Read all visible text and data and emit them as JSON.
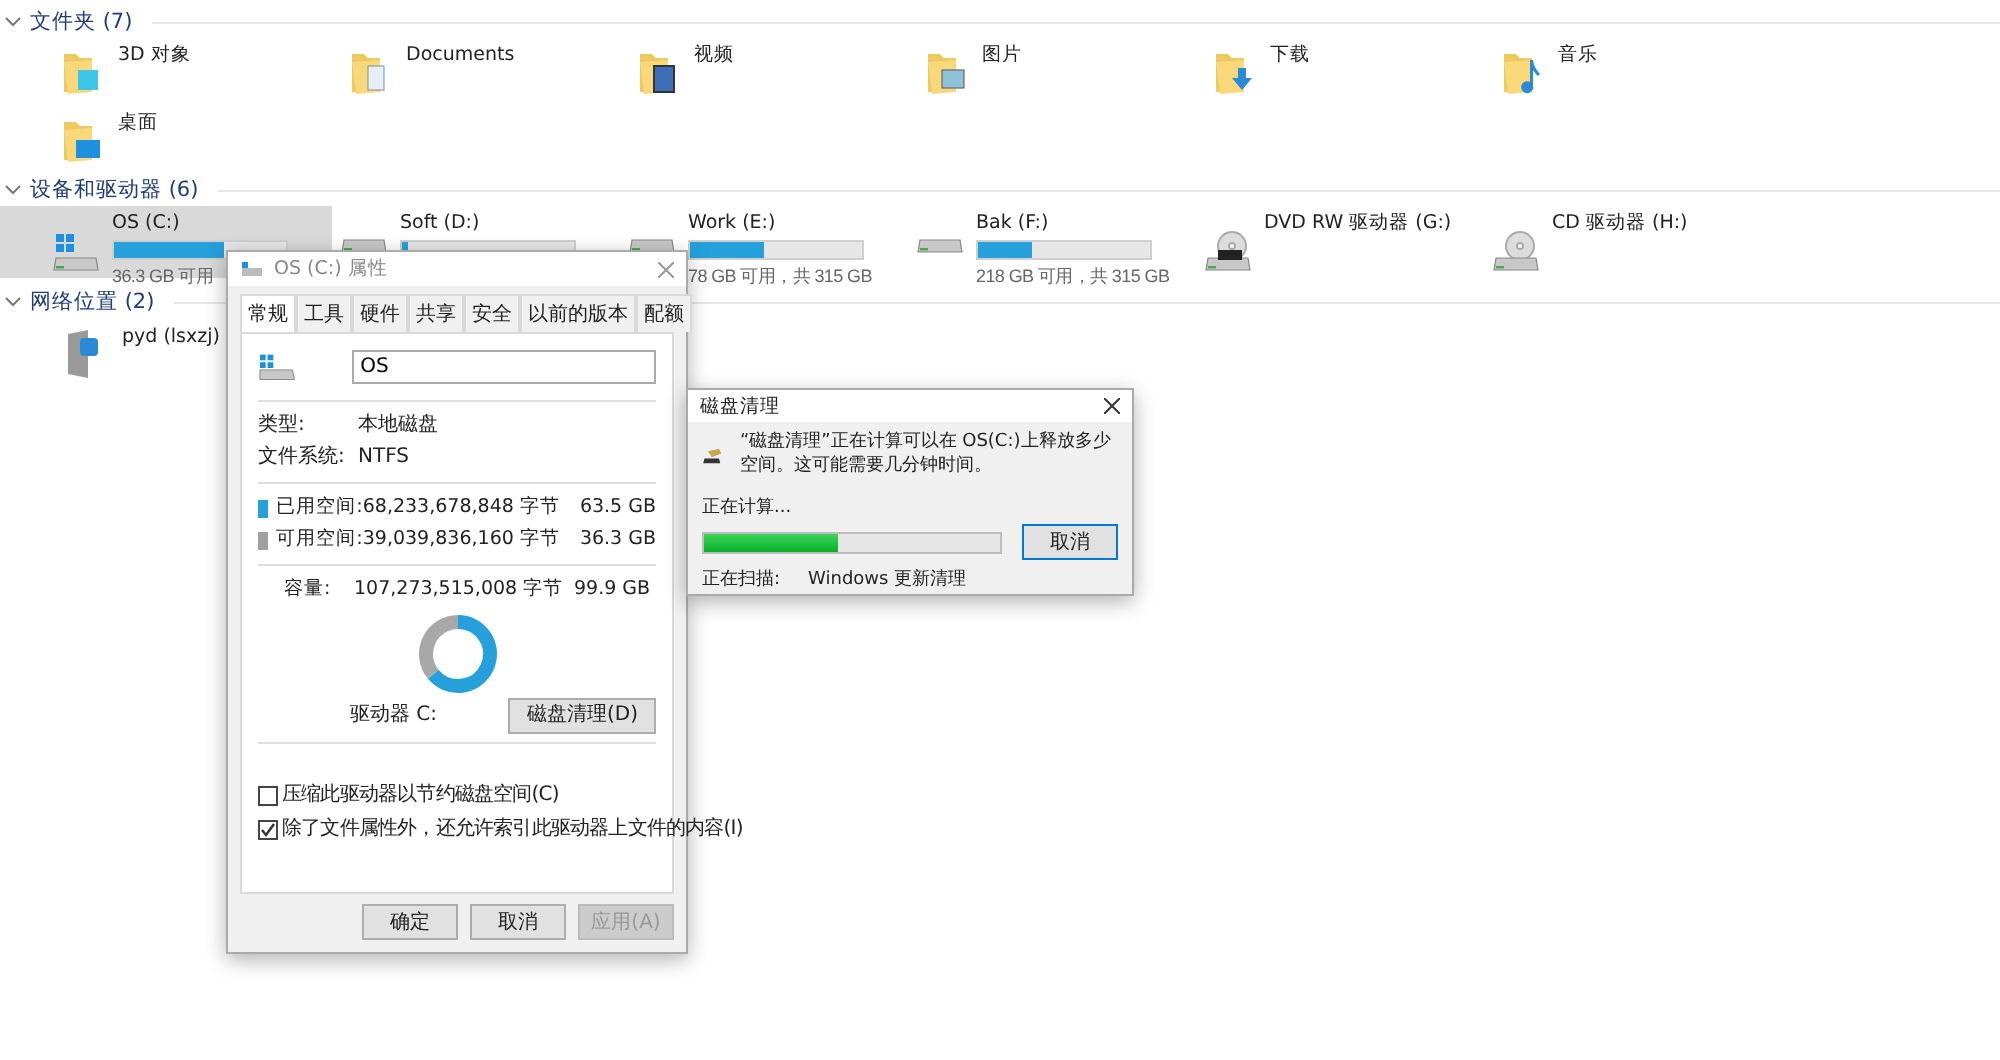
{
  "groups": [
    {
      "title": "文件夹 (7)",
      "kind": "folders",
      "items": [
        {
          "name": "3D 对象",
          "kind": "objects"
        },
        {
          "name": "Documents",
          "kind": "documents"
        },
        {
          "name": "视频",
          "kind": "videos"
        },
        {
          "name": "图片",
          "kind": "pictures"
        },
        {
          "name": "下载",
          "kind": "downloads"
        },
        {
          "name": "音乐",
          "kind": "music"
        },
        {
          "name": "桌面",
          "kind": "desktop"
        }
      ]
    },
    {
      "title": "设备和驱动器 (6)",
      "kind": "drives",
      "items": [
        {
          "name": "OS (C:)",
          "kind": "system",
          "selected": true,
          "level": 0.64,
          "subtitle": "36.3 GB 可用"
        },
        {
          "name": "Soft (D:)",
          "kind": "hdd",
          "selected": false,
          "level": 0.03
        },
        {
          "name": "Work (E:)",
          "kind": "hdd",
          "selected": false,
          "level": 0.43,
          "subtitle": "78 GB 可用，共 315 GB"
        },
        {
          "name": "Bak (F:)",
          "kind": "hdd",
          "selected": false,
          "level": 0.31,
          "subtitle": "218 GB 可用，共 315 GB"
        },
        {
          "name": "DVD RW 驱动器 (G:)",
          "kind": "dvd",
          "selected": false
        },
        {
          "name": "CD 驱动器 (H:)",
          "kind": "cd",
          "selected": false
        }
      ]
    },
    {
      "title": "网络位置 (2)",
      "kind": "network",
      "items": [
        {
          "name": "pyd (lsxzj)",
          "kind": "share"
        }
      ]
    }
  ],
  "properties": {
    "title": "OS (C:) 属性",
    "tabs": [
      {
        "label": "常规",
        "selected": true
      },
      {
        "label": "工具",
        "selected": false
      },
      {
        "label": "硬件",
        "selected": false
      },
      {
        "label": "共享",
        "selected": false
      },
      {
        "label": "安全",
        "selected": false
      },
      {
        "label": "以前的版本",
        "selected": false
      },
      {
        "label": "配额",
        "selected": false
      }
    ],
    "name_value": "OS",
    "info": [
      {
        "label": "类型:",
        "value": "本地磁盘"
      },
      {
        "label": "文件系统:",
        "value": "NTFS"
      }
    ],
    "space": [
      {
        "label": "已用空间:",
        "bytes": "68,233,678,848 字节",
        "size": "63.5 GB",
        "color": "#26a0da"
      },
      {
        "label": "可用空间:",
        "bytes": "39,039,836,160 字节",
        "size": "36.3 GB",
        "color": "#a0a0a0"
      }
    ],
    "capacity": {
      "label": "容量:",
      "bytes": "107,273,515,008 字节",
      "size": "99.9 GB"
    },
    "drive_label": "驱动器 C:",
    "cleanup_button": "磁盘清理(D)",
    "options": [
      {
        "label": "压缩此驱动器以节约磁盘空间(C)",
        "checked": false
      },
      {
        "label": "除了文件属性外，还允许索引此驱动器上文件的内容(I)",
        "checked": true
      }
    ],
    "buttons": [
      {
        "label": "确定",
        "disabled": false
      },
      {
        "label": "取消",
        "disabled": false
      },
      {
        "label": "应用(A)",
        "disabled": true
      }
    ]
  },
  "cleanup": {
    "title": "磁盘清理",
    "message": "“磁盘清理”正在计算可以在 OS(C:)上释放多少空间。这可能需要几分钟时间。",
    "status": "正在计算...",
    "level": 0.45,
    "cancel": "取消",
    "scan_label": "正在扫描:",
    "scan_value": "Windows 更新清理"
  }
}
